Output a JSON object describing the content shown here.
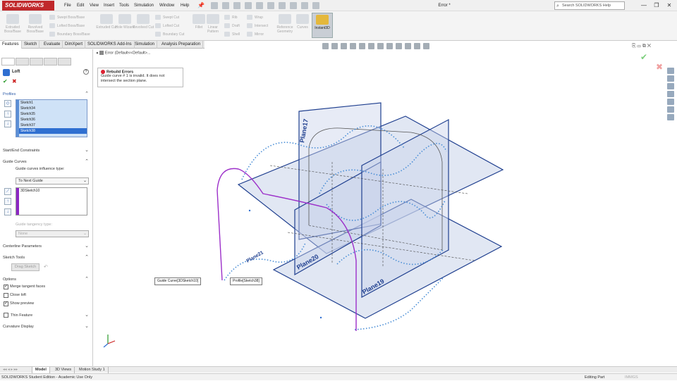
{
  "app": {
    "logo": "SOLIDWORKS",
    "doc_title": "Error *"
  },
  "menu": [
    "File",
    "Edit",
    "View",
    "Insert",
    "Tools",
    "Simulation",
    "Window",
    "Help"
  ],
  "search": {
    "placeholder": "Search SOLIDWORKS Help"
  },
  "window_controls": {
    "minimize": "—",
    "restore": "❐",
    "close": "✕"
  },
  "ribbon": {
    "extruded_boss": "Extruded Boss/Base",
    "revolved_boss": "Revolved Boss/Base",
    "swept_boss": "Swept Boss/Base",
    "lofted_boss": "Lofted Boss/Base",
    "boundary_boss": "Boundary Boss/Base",
    "extruded_cut": "Extruded Cut",
    "hole_wizard": "Hole Wizard",
    "revolved_cut": "Revolved Cut",
    "swept_cut": "Swept Cut",
    "lofted_cut": "Lofted Cut",
    "boundary_cut": "Boundary Cut",
    "fillet": "Fillet",
    "linear_pattern": "Linear Pattern",
    "rib": "Rib",
    "draft": "Draft",
    "shell": "Shell",
    "wrap": "Wrap",
    "intersect": "Intersect",
    "mirror": "Mirror",
    "reference_geometry": "Reference Geometry",
    "curves": "Curves",
    "instant3d": "Instant3D"
  },
  "cm_tabs": [
    "Features",
    "Sketch",
    "Evaluate",
    "DimXpert",
    "SOLIDWORKS Add-Ins",
    "Simulation",
    "Analysis Preparation"
  ],
  "tree_row": "Error  (Default<<Default>...",
  "property_manager": {
    "title": "Loft",
    "ok": "✔",
    "cancel": "✖",
    "help": "?",
    "profiles_header": "Profiles",
    "profiles": [
      "Sketch1",
      "Sketch34",
      "Sketch35",
      "Sketch36",
      "Sketch37",
      "Sketch38"
    ],
    "selected_profile": "Sketch38",
    "start_end_constraints": "Start/End Constraints",
    "guide_curves_header": "Guide Curves",
    "guide_influence_label": "Guide curves influence type:",
    "guide_influence_value": "To Next Guide",
    "guides": [
      "3DSketch10"
    ],
    "guide_tangency_label": "Guide tangency type:",
    "guide_tangency_value": "None",
    "centerline_parameters": "Centerline Parameters",
    "sketch_tools": "Sketch Tools",
    "drag_sketch": "Drag Sketch",
    "options_header": "Options",
    "merge_tangent_faces": "Merge tangent faces",
    "merge_tangent_faces_checked": true,
    "close_loft": "Close loft",
    "close_loft_checked": false,
    "show_preview": "Show preview",
    "show_preview_checked": true,
    "thin_feature": "Thin Feature",
    "thin_feature_checked": false,
    "curvature_display": "Curvature Display"
  },
  "error": {
    "title": "Rebuild Errors",
    "message": "Guide curve # 1 is invalid. It does not intersect the section plane."
  },
  "viewport": {
    "plane_labels": [
      "Plane17",
      "Plane20",
      "Plane19",
      "Plane21"
    ],
    "callout_guide": "Guide Curve[3DSketch10]",
    "callout_profile": "Profile[Sketch38]",
    "colors": {
      "plane_edge": "#1f3f8f",
      "plane_fill": "#c9d3ea",
      "curve": "#4a8ed6",
      "guide": "#9c2fc9",
      "accent": "#2f6fd1"
    }
  },
  "bottom_tabs": [
    "Model",
    "3D Views",
    "Motion Study 1"
  ],
  "status": {
    "left": "SOLIDWORKS Student Edition - Academic Use Only",
    "mode": "Editing Part",
    "units": "IMMGS"
  }
}
